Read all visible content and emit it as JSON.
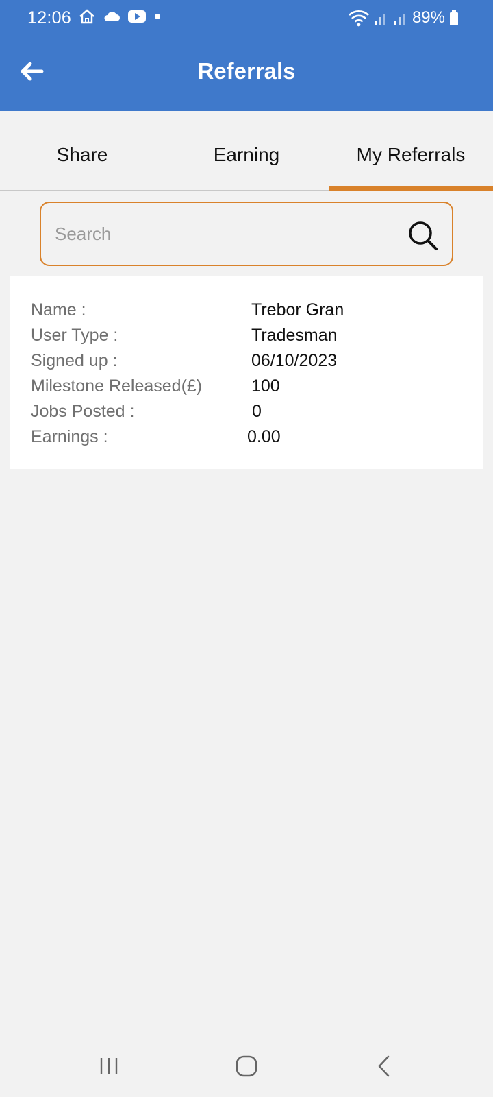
{
  "status_bar": {
    "time": "12:06",
    "left_icons": [
      "home-icon",
      "cloud-icon",
      "youtube-icon",
      "dot-icon"
    ],
    "right_icons": [
      "wifi-icon",
      "signal-icon",
      "signal-icon"
    ],
    "battery": "89%"
  },
  "app_bar": {
    "title": "Referrals",
    "back_icon": "arrow-left-icon",
    "color": "#3f79cb"
  },
  "tabs": [
    {
      "label": "Share",
      "active": false
    },
    {
      "label": "Earning",
      "active": false
    },
    {
      "label": "My Referrals",
      "active": true
    }
  ],
  "accent_color": "#d9822b",
  "search": {
    "placeholder": "Search",
    "value": "",
    "icon": "search-icon"
  },
  "referral": {
    "rows": [
      {
        "label": "Name :",
        "value": "Trebor Gran"
      },
      {
        "label": "User Type :",
        "value": "Tradesman"
      },
      {
        "label": "Signed up :",
        "value": "06/10/2023"
      },
      {
        "label": "Milestone Released(£)",
        "value": "100"
      },
      {
        "label": "Jobs Posted :",
        "value": "0"
      },
      {
        "label": "Earnings :",
        "value": "0.00"
      }
    ]
  },
  "nav_bar": {
    "buttons": [
      "recents-icon",
      "home-button-icon",
      "back-nav-icon"
    ]
  }
}
